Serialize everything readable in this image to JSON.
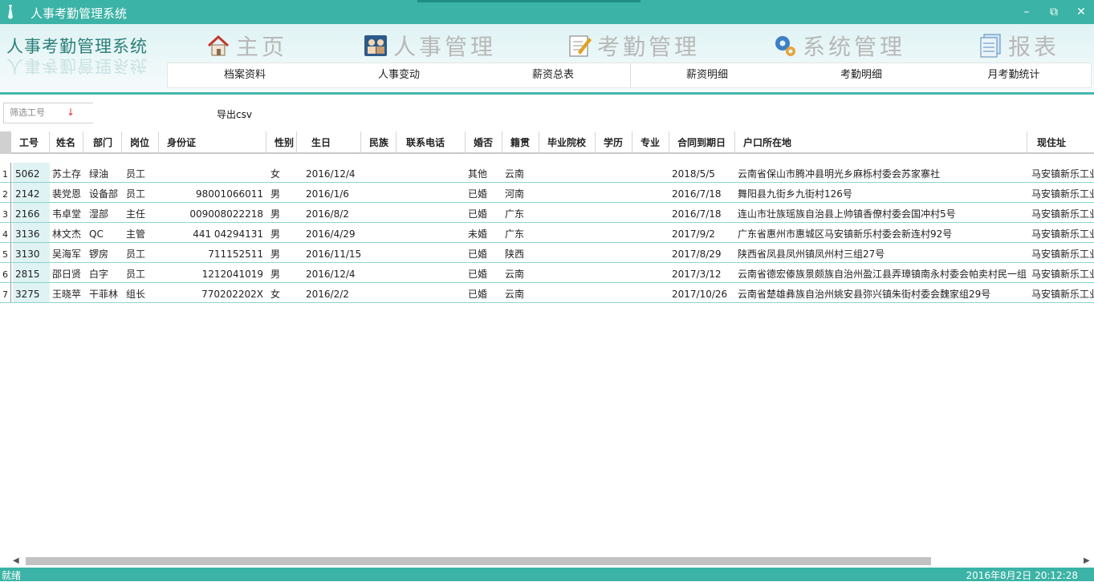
{
  "window": {
    "title": "人事考勤管理系统",
    "min_icon": "minimize-icon",
    "restore_icon": "restore-icon",
    "close_icon": "close-icon"
  },
  "logo": {
    "text": "人事考勤管理系统"
  },
  "main_nav": [
    {
      "label": "主页",
      "icon": "home-icon"
    },
    {
      "label": "人事管理",
      "icon": "personnel-icon"
    },
    {
      "label": "考勤管理",
      "icon": "attendance-icon"
    },
    {
      "label": "系统管理",
      "icon": "gear-icon"
    },
    {
      "label": "报表",
      "icon": "report-icon"
    }
  ],
  "sub_nav": [
    "档案资料",
    "人事变动",
    "薪资总表",
    "薪资明细",
    "考勤明细",
    "月考勤统计"
  ],
  "toolbar": {
    "filter_placeholder": "筛选工号",
    "export_label": "导出csv"
  },
  "table": {
    "columns": [
      "工号",
      "姓名",
      "部门",
      "岗位",
      "身份证",
      "性别",
      "生日",
      "民族",
      "联系电话",
      "婚否",
      "籍贯",
      "毕业院校",
      "学历",
      "专业",
      "合同到期日",
      "户口所在地",
      "现住址"
    ],
    "rows": [
      {
        "num": "1",
        "id": "5062",
        "name": "苏土存",
        "dept": "绿油",
        "post": "员工",
        "idcard": "",
        "gender": "女",
        "birthday": "2016/12/4",
        "nation": "",
        "phone": "",
        "married": "其他",
        "native": "云南",
        "school": "",
        "edu": "",
        "major": "",
        "contract": "2018/5/5",
        "hukou": "云南省保山市腾冲县明光乡麻栎村委会苏家寨社",
        "address": "马安镇新乐工业"
      },
      {
        "num": "2",
        "id": "2142",
        "name": "裴党恩",
        "dept": "设备部",
        "post": "员工",
        "idcard": "98001066011",
        "gender": "男",
        "birthday": "2016/1/6",
        "nation": "",
        "phone": "",
        "married": "已婚",
        "native": "河南",
        "school": "",
        "edu": "",
        "major": "",
        "contract": "2016/7/18",
        "hukou": "舞阳县九街乡九街村126号",
        "address": "马安镇新乐工业"
      },
      {
        "num": "3",
        "id": "2166",
        "name": "韦卓堂",
        "dept": "湿部",
        "post": "主任",
        "idcard": "009008022218",
        "gender": "男",
        "birthday": "2016/8/2",
        "nation": "",
        "phone": "",
        "married": "已婚",
        "native": "广东",
        "school": "",
        "edu": "",
        "major": "",
        "contract": "2016/7/18",
        "hukou": "连山市壮族瑶族自治县上帅镇香僚村委会国冲村5号",
        "address": "马安镇新乐工业"
      },
      {
        "num": "4",
        "id": "3136",
        "name": "林文杰",
        "dept": "QC",
        "post": "主管",
        "idcard": "441        04294131",
        "gender": "男",
        "birthday": "2016/4/29",
        "nation": "",
        "phone": "",
        "married": "未婚",
        "native": "广东",
        "school": "",
        "edu": "",
        "major": "",
        "contract": "2017/9/2",
        "hukou": "广东省惠州市惠城区马安镇新乐村委会新连村92号",
        "address": "马安镇新乐工业"
      },
      {
        "num": "5",
        "id": "3130",
        "name": "吴海军",
        "dept": "锣房",
        "post": "员工",
        "idcard": "711152511",
        "gender": "男",
        "birthday": "2016/11/15",
        "nation": "",
        "phone": "",
        "married": "已婚",
        "native": "陕西",
        "school": "",
        "edu": "",
        "major": "",
        "contract": "2017/8/29",
        "hukou": "陕西省凤县凤州镇凤州村三组27号",
        "address": "马安镇新乐工业"
      },
      {
        "num": "6",
        "id": "2815",
        "name": "邵日贤",
        "dept": "白字",
        "post": "员工",
        "idcard": "1212041019",
        "gender": "男",
        "birthday": "2016/12/4",
        "nation": "",
        "phone": "",
        "married": "已婚",
        "native": "云南",
        "school": "",
        "edu": "",
        "major": "",
        "contract": "2017/3/12",
        "hukou": "云南省德宏傣族景颇族自治州盈江县弄璋镇南永村委会帕卖村民一组",
        "address": "马安镇新乐工业"
      },
      {
        "num": "7",
        "id": "3275",
        "name": "王晓苹",
        "dept": "干菲林",
        "post": "组长",
        "idcard": "770202202X",
        "gender": "女",
        "birthday": "2016/2/2",
        "nation": "",
        "phone": "",
        "married": "已婚",
        "native": "云南",
        "school": "",
        "edu": "",
        "major": "",
        "contract": "2017/10/26",
        "hukou": "云南省楚雄彝族自治州姚安县弥兴镇朱街村委会魏家组29号",
        "address": "马安镇新乐工业"
      }
    ]
  },
  "status": {
    "left": "就绪",
    "right": "2016年8月2日 20:12:28"
  },
  "colors": {
    "accent": "#3bb3a6",
    "header_bg": "#dff3f4",
    "row_line": "#8ed3cc"
  }
}
